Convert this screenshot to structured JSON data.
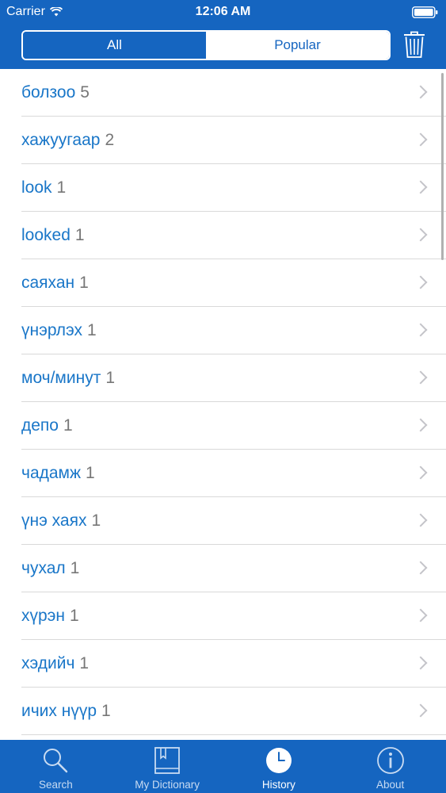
{
  "status_bar": {
    "carrier": "Carrier",
    "time": "12:06 AM"
  },
  "segmented": {
    "all_label": "All",
    "popular_label": "Popular",
    "selected": "All"
  },
  "header": {
    "clear_icon": "trash-icon"
  },
  "history": {
    "items": [
      {
        "word": "болзоо",
        "count": "5"
      },
      {
        "word": "хажуугаар",
        "count": "2"
      },
      {
        "word": "look",
        "count": "1"
      },
      {
        "word": "looked",
        "count": "1"
      },
      {
        "word": "саяхан",
        "count": "1"
      },
      {
        "word": "үнэрлэх",
        "count": "1"
      },
      {
        "word": "моч/минут",
        "count": "1"
      },
      {
        "word": "депо",
        "count": "1"
      },
      {
        "word": "чадамж",
        "count": "1"
      },
      {
        "word": "үнэ хаях",
        "count": "1"
      },
      {
        "word": "чухал",
        "count": "1"
      },
      {
        "word": "хүрэн",
        "count": "1"
      },
      {
        "word": "хэдийч",
        "count": "1"
      },
      {
        "word": "ичих нүүр",
        "count": "1"
      },
      {
        "word": "",
        "count": ""
      }
    ]
  },
  "tabbar": {
    "tabs": [
      {
        "label": "Search",
        "icon": "search-icon"
      },
      {
        "label": "My Dictionary",
        "icon": "book-icon"
      },
      {
        "label": "History",
        "icon": "clock-icon"
      },
      {
        "label": "About",
        "icon": "info-icon"
      }
    ],
    "selected": "History"
  },
  "colors": {
    "brand_blue": "#1565c0",
    "link_blue": "#1976c8",
    "count_gray": "#777777",
    "separator": "#d9d9d9"
  }
}
